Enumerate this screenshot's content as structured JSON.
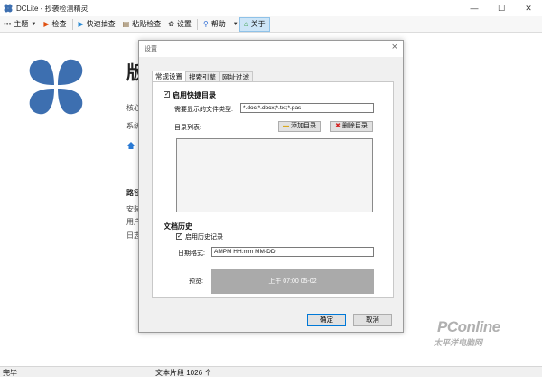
{
  "window": {
    "title": "DCLite - 抄袭检测精灵",
    "controls": [
      "—",
      "☐",
      "✕"
    ]
  },
  "toolbar": {
    "menu_label": "主题",
    "check_label": "检查",
    "quick_extract_label": "快速抽查",
    "paste_check_label": "粘贴检查",
    "settings_label": "设置",
    "help_label": "帮助",
    "about_label": "关于"
  },
  "background": {
    "heading": "版",
    "line1": "核心",
    "line2": "系统",
    "path_label": "路径",
    "item1": "安装",
    "item2": "用户",
    "item3": "日志"
  },
  "status": {
    "left": "完毕",
    "middle": "文本片段 1026 个"
  },
  "watermark": {
    "line1": "PConline",
    "line2": "太平洋电脑网"
  },
  "dialog": {
    "title": "设置",
    "tabs": [
      "常规设置",
      "搜索引擎",
      "网址过滤"
    ],
    "selected_tab": 0,
    "quick_dir": {
      "enabled_label": "启用快捷目录",
      "enabled": true,
      "filetype_label": "需要显示的文件类型:",
      "filetype_value": "*.doc;*.docx;*.txt;*.pas",
      "dirlist_label": "目录列表:",
      "add_label": "添加目录",
      "delete_label": "删除目录",
      "directories": []
    },
    "history": {
      "section_label": "文档历史",
      "enabled_label": "启用历史记录",
      "enabled": true,
      "date_format_label": "日期格式:",
      "date_format_value": "AMPM HH:mm MM-DD",
      "preview_label": "预览:",
      "preview_value": "上午 07:00 05-02"
    },
    "ok_label": "确定",
    "cancel_label": "取消"
  },
  "colors": {
    "accent": "#3d6fb0",
    "preview_bg": "#aaaaaa",
    "active_tool": "#cde5f7"
  }
}
